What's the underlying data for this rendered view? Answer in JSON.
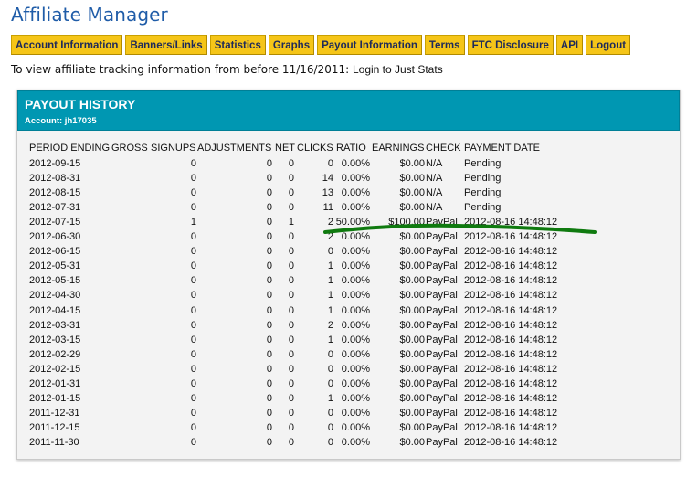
{
  "page": {
    "title": "Affiliate Manager",
    "intro_text": "To view affiliate tracking information from before 11/16/2011:",
    "intro_link": "Login to Just Stats"
  },
  "nav": [
    {
      "label": "Account Information"
    },
    {
      "label": "Banners/Links"
    },
    {
      "label": "Statistics"
    },
    {
      "label": "Graphs"
    },
    {
      "label": "Payout Information"
    },
    {
      "label": "Terms"
    },
    {
      "label": "FTC Disclosure"
    },
    {
      "label": "API"
    },
    {
      "label": "Logout"
    }
  ],
  "colors": {
    "nav_button_bg": "#f5c518",
    "panel_header_bg": "#0097b2",
    "title_color": "#1f5ca8",
    "annotation_green": "#0f7a0f"
  },
  "payout": {
    "title": "PAYOUT HISTORY",
    "account": "Account: jh17035",
    "headers": {
      "period": "PERIOD ENDING",
      "gross": "GROSS",
      "signups": "SIGNUPS",
      "adjustments": "ADJUSTMENTS",
      "net": "NET",
      "clicks": "CLICKS",
      "ratio": "RATIO",
      "earnings": "EARNINGS",
      "check": "CHECK",
      "payment_date": "PAYMENT DATE"
    },
    "rows": [
      {
        "period": "2012-09-15",
        "gross": "0",
        "adjustments": "0",
        "net": "0",
        "clicks": "0",
        "ratio": "0.00%",
        "earnings": "$0.00",
        "check": "N/A",
        "payment_date": "Pending"
      },
      {
        "period": "2012-08-31",
        "gross": "0",
        "adjustments": "0",
        "net": "0",
        "clicks": "14",
        "ratio": "0.00%",
        "earnings": "$0.00",
        "check": "N/A",
        "payment_date": "Pending"
      },
      {
        "period": "2012-08-15",
        "gross": "0",
        "adjustments": "0",
        "net": "0",
        "clicks": "13",
        "ratio": "0.00%",
        "earnings": "$0.00",
        "check": "N/A",
        "payment_date": "Pending"
      },
      {
        "period": "2012-07-31",
        "gross": "0",
        "adjustments": "0",
        "net": "0",
        "clicks": "11",
        "ratio": "0.00%",
        "earnings": "$0.00",
        "check": "N/A",
        "payment_date": "Pending"
      },
      {
        "period": "2012-07-15",
        "gross": "1",
        "adjustments": "0",
        "net": "1",
        "clicks": "2",
        "ratio": "50.00%",
        "earnings": "$100.00",
        "check": "PayPal",
        "payment_date": "2012-08-16 14:48:12"
      },
      {
        "period": "2012-06-30",
        "gross": "0",
        "adjustments": "0",
        "net": "0",
        "clicks": "2",
        "ratio": "0.00%",
        "earnings": "$0.00",
        "check": "PayPal",
        "payment_date": "2012-08-16 14:48:12"
      },
      {
        "period": "2012-06-15",
        "gross": "0",
        "adjustments": "0",
        "net": "0",
        "clicks": "0",
        "ratio": "0.00%",
        "earnings": "$0.00",
        "check": "PayPal",
        "payment_date": "2012-08-16 14:48:12"
      },
      {
        "period": "2012-05-31",
        "gross": "0",
        "adjustments": "0",
        "net": "0",
        "clicks": "1",
        "ratio": "0.00%",
        "earnings": "$0.00",
        "check": "PayPal",
        "payment_date": "2012-08-16 14:48:12"
      },
      {
        "period": "2012-05-15",
        "gross": "0",
        "adjustments": "0",
        "net": "0",
        "clicks": "1",
        "ratio": "0.00%",
        "earnings": "$0.00",
        "check": "PayPal",
        "payment_date": "2012-08-16 14:48:12"
      },
      {
        "period": "2012-04-30",
        "gross": "0",
        "adjustments": "0",
        "net": "0",
        "clicks": "1",
        "ratio": "0.00%",
        "earnings": "$0.00",
        "check": "PayPal",
        "payment_date": "2012-08-16 14:48:12"
      },
      {
        "period": "2012-04-15",
        "gross": "0",
        "adjustments": "0",
        "net": "0",
        "clicks": "1",
        "ratio": "0.00%",
        "earnings": "$0.00",
        "check": "PayPal",
        "payment_date": "2012-08-16 14:48:12"
      },
      {
        "period": "2012-03-31",
        "gross": "0",
        "adjustments": "0",
        "net": "0",
        "clicks": "2",
        "ratio": "0.00%",
        "earnings": "$0.00",
        "check": "PayPal",
        "payment_date": "2012-08-16 14:48:12"
      },
      {
        "period": "2012-03-15",
        "gross": "0",
        "adjustments": "0",
        "net": "0",
        "clicks": "1",
        "ratio": "0.00%",
        "earnings": "$0.00",
        "check": "PayPal",
        "payment_date": "2012-08-16 14:48:12"
      },
      {
        "period": "2012-02-29",
        "gross": "0",
        "adjustments": "0",
        "net": "0",
        "clicks": "0",
        "ratio": "0.00%",
        "earnings": "$0.00",
        "check": "PayPal",
        "payment_date": "2012-08-16 14:48:12"
      },
      {
        "period": "2012-02-15",
        "gross": "0",
        "adjustments": "0",
        "net": "0",
        "clicks": "0",
        "ratio": "0.00%",
        "earnings": "$0.00",
        "check": "PayPal",
        "payment_date": "2012-08-16 14:48:12"
      },
      {
        "period": "2012-01-31",
        "gross": "0",
        "adjustments": "0",
        "net": "0",
        "clicks": "0",
        "ratio": "0.00%",
        "earnings": "$0.00",
        "check": "PayPal",
        "payment_date": "2012-08-16 14:48:12"
      },
      {
        "period": "2012-01-15",
        "gross": "0",
        "adjustments": "0",
        "net": "0",
        "clicks": "1",
        "ratio": "0.00%",
        "earnings": "$0.00",
        "check": "PayPal",
        "payment_date": "2012-08-16 14:48:12"
      },
      {
        "period": "2011-12-31",
        "gross": "0",
        "adjustments": "0",
        "net": "0",
        "clicks": "0",
        "ratio": "0.00%",
        "earnings": "$0.00",
        "check": "PayPal",
        "payment_date": "2012-08-16 14:48:12"
      },
      {
        "period": "2011-12-15",
        "gross": "0",
        "adjustments": "0",
        "net": "0",
        "clicks": "0",
        "ratio": "0.00%",
        "earnings": "$0.00",
        "check": "PayPal",
        "payment_date": "2012-08-16 14:48:12"
      },
      {
        "period": "2011-11-30",
        "gross": "0",
        "adjustments": "0",
        "net": "0",
        "clicks": "0",
        "ratio": "0.00%",
        "earnings": "$0.00",
        "check": "PayPal",
        "payment_date": "2012-08-16 14:48:12"
      }
    ]
  }
}
